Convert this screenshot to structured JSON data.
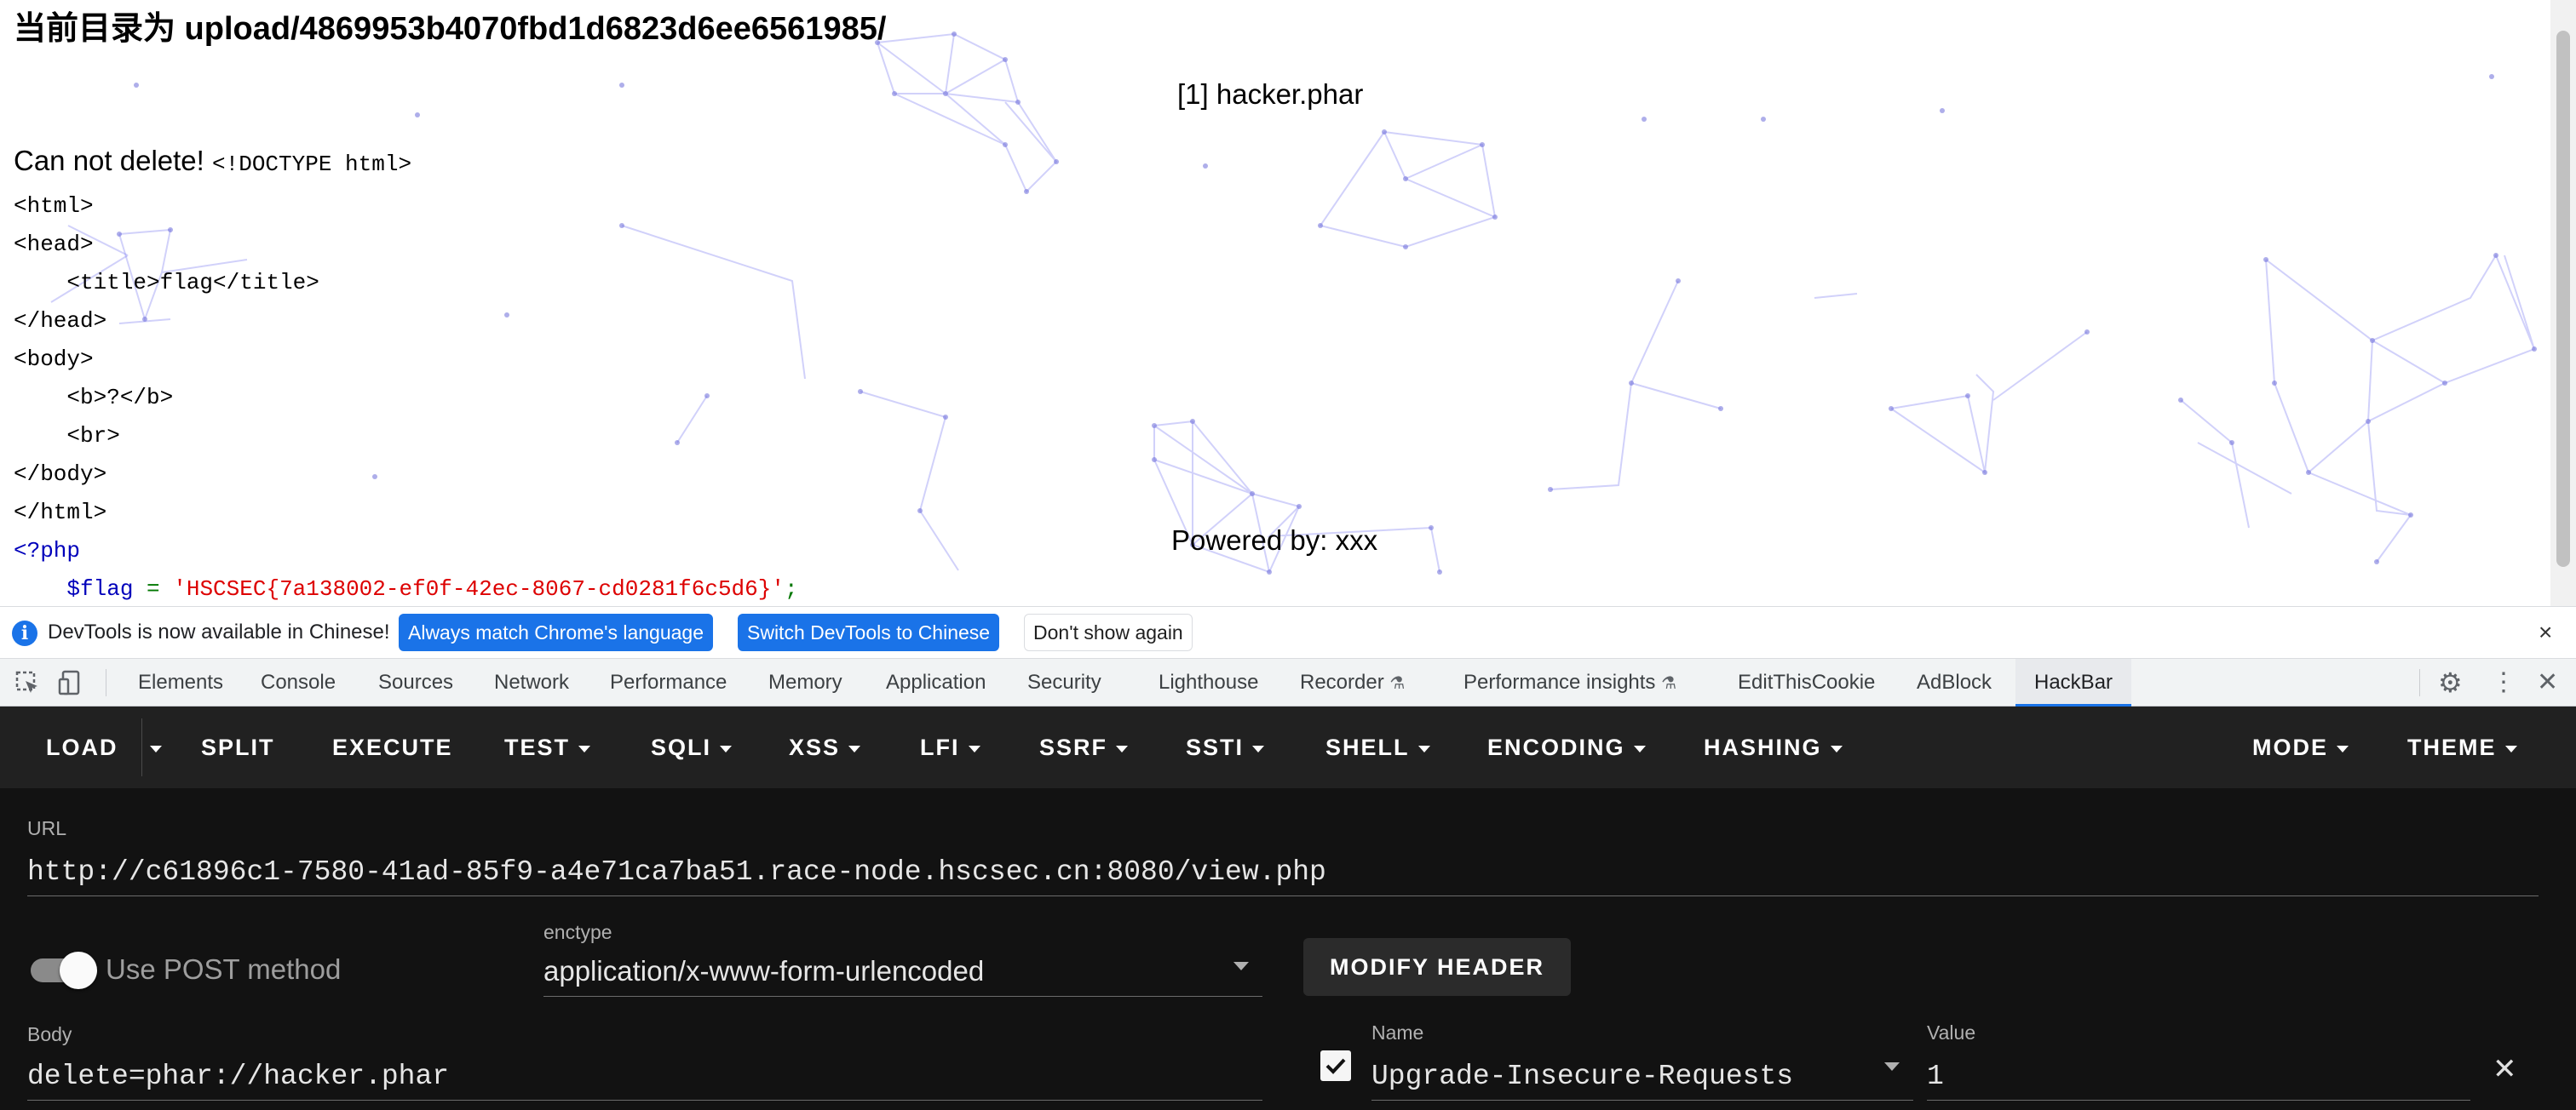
{
  "page": {
    "title": "当前目录为 upload/4869953b4070fbd1d6823d6ee6561985/",
    "file_entry": "[1] hacker.phar",
    "output_message": "Can not delete!",
    "code_first_line": "<!DOCTYPE html>",
    "code_lines": [
      "<html>",
      "<head>",
      "    <title>flag</title>",
      "</head>",
      "<body>",
      "    <b>?</b>",
      "    <br>",
      "</body>",
      "</html>"
    ],
    "php_open": "<?php",
    "php_var": "$flag",
    "php_op": " = ",
    "php_string": "'HSCSEC{7a138002-ef0f-42ec-8067-cd0281f6c5d6}'",
    "php_end": ";",
    "powered_by": "Powered by: xxx"
  },
  "infobar": {
    "icon": "info-icon",
    "message": "DevTools is now available in Chinese!",
    "btn_match": "Always match Chrome's language",
    "btn_switch": "Switch DevTools to Chinese",
    "btn_dont_show": "Don't show again",
    "close": "×"
  },
  "devtools": {
    "tabs": [
      "Elements",
      "Console",
      "Sources",
      "Network",
      "Performance",
      "Memory",
      "Application",
      "Security",
      "Lighthouse",
      "Recorder",
      "Performance insights",
      "EditThisCookie",
      "AdBlock",
      "HackBar"
    ],
    "experimental_mark": "⚗",
    "active_tab": "HackBar",
    "settings_icon": "⚙",
    "more_icon": "⋮",
    "close_icon": "✕"
  },
  "hackbar": {
    "toolbar": {
      "load": "LOAD",
      "split": "SPLIT",
      "execute": "EXECUTE",
      "test": "TEST",
      "sqli": "SQLI",
      "xss": "XSS",
      "lfi": "LFI",
      "ssrf": "SSRF",
      "ssti": "SSTI",
      "shell": "SHELL",
      "encoding": "ENCODING",
      "hashing": "HASHING",
      "mode": "MODE",
      "theme": "THEME"
    },
    "url_label": "URL",
    "url_value": "http://c61896c1-7580-41ad-85f9-a4e71ca7ba51.race-node.hscsec.cn:8080/view.php",
    "post_toggle_label": "Use POST method",
    "post_enabled": true,
    "enctype_label": "enctype",
    "enctype_value": "application/x-www-form-urlencoded",
    "modify_header": "MODIFY HEADER",
    "body_label": "Body",
    "body_value": "delete=phar://hacker.phar",
    "header_enabled": true,
    "header_name_label": "Name",
    "header_name_value": "Upgrade-Insecure-Requests",
    "header_value_label": "Value",
    "header_value_value": "1",
    "remove_icon": "✕"
  },
  "colors": {
    "accent": "#1a73e8",
    "hackbar_bg": "#121212",
    "hackbar_toolbar": "#212121",
    "php_keyword": "#0000bb",
    "php_string": "#dd0000",
    "php_operator": "#007700"
  }
}
